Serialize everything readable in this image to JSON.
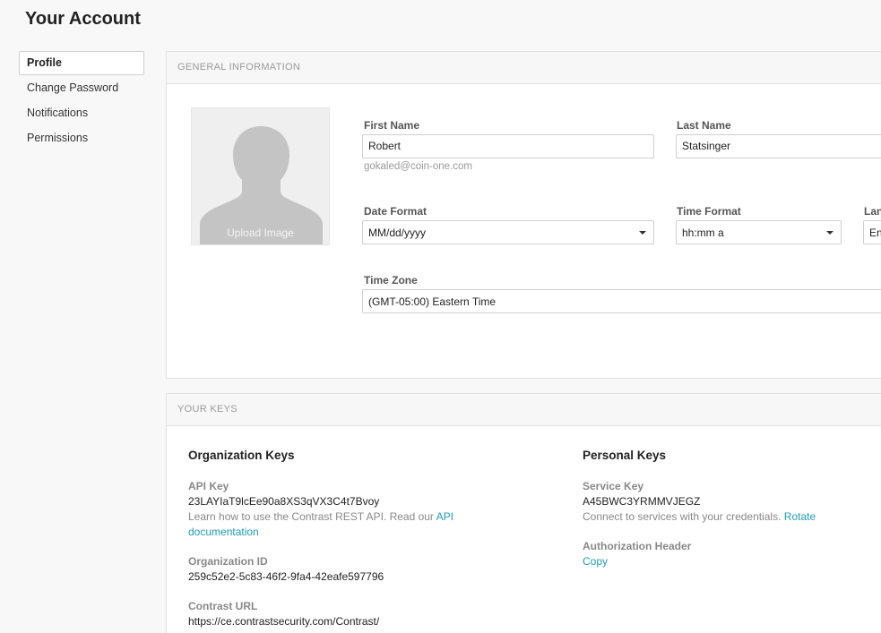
{
  "page": {
    "title": "Your Account"
  },
  "sidebar": {
    "items": [
      {
        "label": "Profile"
      },
      {
        "label": "Change Password"
      },
      {
        "label": "Notifications"
      },
      {
        "label": "Permissions"
      }
    ]
  },
  "general": {
    "header": "GENERAL INFORMATION",
    "avatar": {
      "upload_label": "Upload Image",
      "icon": "user-silhouette-icon"
    },
    "first_name": {
      "label": "First Name",
      "value": "Robert"
    },
    "last_name": {
      "label": "Last Name",
      "value": "Statsinger"
    },
    "email": "gokaled@coin-one.com",
    "date_format": {
      "label": "Date Format",
      "value": "MM/dd/yyyy"
    },
    "time_format": {
      "label": "Time Format",
      "value": "hh:mm a"
    },
    "language": {
      "label": "Lan",
      "value": "En"
    },
    "time_zone": {
      "label": "Time Zone",
      "value": "(GMT-05:00) Eastern Time"
    }
  },
  "keys": {
    "header": "YOUR KEYS",
    "org": {
      "heading": "Organization Keys",
      "api_key_label": "API Key",
      "api_key_value": "23LAYIaT9lcEe90a8XS3qVX3C4t7Bvoy",
      "api_note_text": "Learn how to use the Contrast REST API. Read our",
      "api_note_link_1": "API",
      "api_note_link_2": "documentation",
      "org_id_label": "Organization ID",
      "org_id_value": "259c52e2-5c83-46f2-9fa4-42eafe597796",
      "url_label": "Contrast URL",
      "url_value": "https://ce.contrastsecurity.com/Contrast/"
    },
    "personal": {
      "heading": "Personal Keys",
      "service_key_label": "Service Key",
      "service_key_value": "A45BWC3YRMMVJEGZ",
      "service_note": "Connect to services with your credentials.",
      "rotate_link": "Rotate",
      "auth_header_label": "Authorization Header",
      "copy_link": "Copy"
    }
  },
  "colors": {
    "link": "#1c9fb8",
    "avatar_bg": "#efefef",
    "silhouette": "#c4c4c4"
  }
}
